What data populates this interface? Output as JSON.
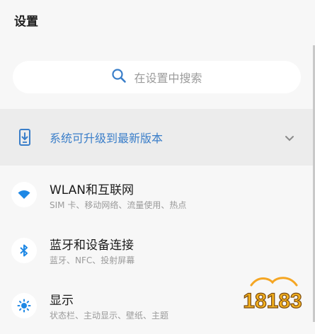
{
  "header": {
    "title": "设置"
  },
  "search": {
    "placeholder": "在设置中搜索",
    "icon": "search-icon"
  },
  "update_banner": {
    "label": "系统可升级到最新版本",
    "accent": "#3a7ec9"
  },
  "settings": [
    {
      "title": "WLAN和互联网",
      "subtitle": "SIM 卡、移动网络、流量使用、热点",
      "icon": "wifi-icon",
      "icon_color": "#1e88e5"
    },
    {
      "title": "蓝牙和设备连接",
      "subtitle": "蓝牙、NFC、投射屏幕",
      "icon": "bluetooth-icon",
      "icon_color": "#1e88e5"
    },
    {
      "title": "显示",
      "subtitle": "状态栏、主动显示、壁纸、主题",
      "icon": "brightness-icon",
      "icon_color": "#1e88e5"
    }
  ],
  "watermark": {
    "text": "18183"
  }
}
